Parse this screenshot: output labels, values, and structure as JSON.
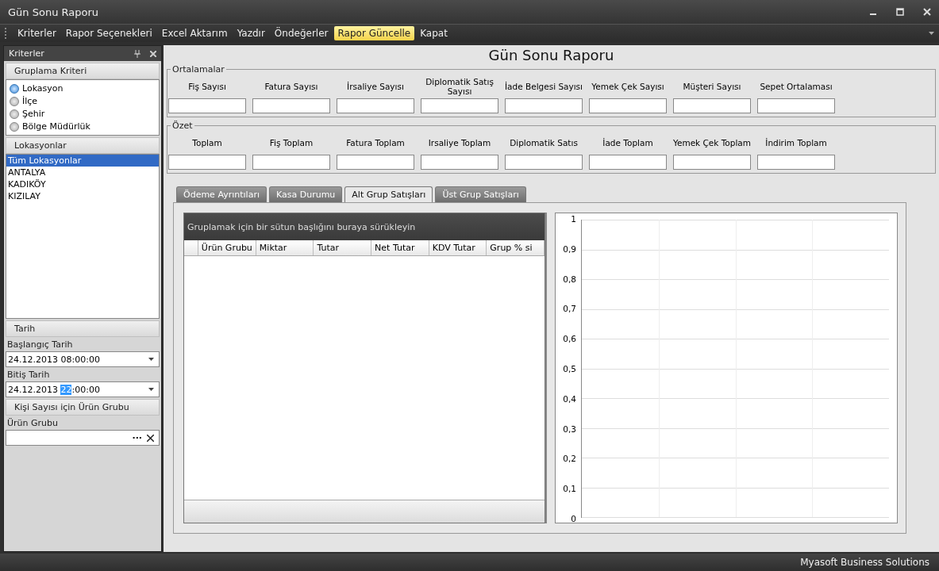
{
  "window": {
    "title": "Gün Sonu Raporu"
  },
  "menu": [
    {
      "label": "Kriterler",
      "selected": false
    },
    {
      "label": "Rapor Seçenekleri",
      "selected": false
    },
    {
      "label": "Excel Aktarım",
      "selected": false
    },
    {
      "label": "Yazdır",
      "selected": false
    },
    {
      "label": "Öndeğerler",
      "selected": false
    },
    {
      "label": "Rapor Güncelle",
      "selected": true
    },
    {
      "label": "Kapat",
      "selected": false
    }
  ],
  "sidebar": {
    "title": "Kriterler",
    "grouping": {
      "title": "Gruplama Kriteri",
      "options": [
        {
          "label": "Lokasyon",
          "selected": true
        },
        {
          "label": "İlçe",
          "selected": false
        },
        {
          "label": "Şehir",
          "selected": false
        },
        {
          "label": "Bölge Müdürlük",
          "selected": false
        }
      ]
    },
    "locations": {
      "title": "Lokasyonlar",
      "items": [
        {
          "label": "Tüm Lokasyonlar",
          "selected": true
        },
        {
          "label": "ANTALYA",
          "selected": false
        },
        {
          "label": "KADIKÖY",
          "selected": false
        },
        {
          "label": "KIZILAY",
          "selected": false
        }
      ]
    },
    "date": {
      "title": "Tarih",
      "fields": [
        {
          "label": "Başlangıç Tarih",
          "value_parts": [
            {
              "text": "24.12.2013 08:00:00",
              "selected": false
            }
          ]
        },
        {
          "label": "Bitiş Tarih",
          "value_parts": [
            {
              "text": "24.12.2013 ",
              "selected": false
            },
            {
              "text": "22",
              "selected": true
            },
            {
              "text": ":00:00",
              "selected": false
            }
          ]
        }
      ]
    },
    "product_group": {
      "title": "Kişi Sayısı için Ürün Grubu",
      "label": "Ürün Grubu",
      "button": "···"
    }
  },
  "report": {
    "title": "Gün Sonu Raporu",
    "sections": [
      {
        "title": "Ortalamalar",
        "fields": [
          "Fiş Sayısı",
          "Fatura Sayısı",
          "İrsaliye Sayısı",
          "Diplomatik Satış Sayısı",
          "İade Belgesi Sayısı",
          "Yemek Çek Sayısı",
          "Müşteri Sayısı",
          "Sepet Ortalaması"
        ]
      },
      {
        "title": "Özet",
        "fields": [
          "Toplam",
          "Fiş Toplam",
          "Fatura Toplam",
          "Irsaliye Toplam",
          "Diplomatik Satıs",
          "İade Toplam",
          "Yemek Çek Toplam",
          "İndirim Toplam"
        ]
      }
    ],
    "tabs": [
      {
        "label": "Ödeme Ayrıntıları",
        "selected": false
      },
      {
        "label": "Kasa Durumu",
        "selected": false
      },
      {
        "label": "Alt Grup Satışları",
        "selected": true
      },
      {
        "label": "Üst Grup Satışları",
        "selected": false
      }
    ],
    "grid": {
      "group_hint": "Gruplamak için bir sütun başlığını buraya sürükleyin",
      "columns": [
        "Ürün Grubu",
        "Miktar",
        "Tutar",
        "Net Tutar",
        "KDV Tutar",
        "Grup % si"
      ]
    },
    "chart": {
      "y_tick_labels": [
        "1",
        "0,9",
        "0,8",
        "0,7",
        "0,6",
        "0,5",
        "0,4",
        "0,3",
        "0,2",
        "0,1",
        "0"
      ]
    }
  },
  "status_bar": {
    "text": "Myasoft Business Solutions"
  }
}
